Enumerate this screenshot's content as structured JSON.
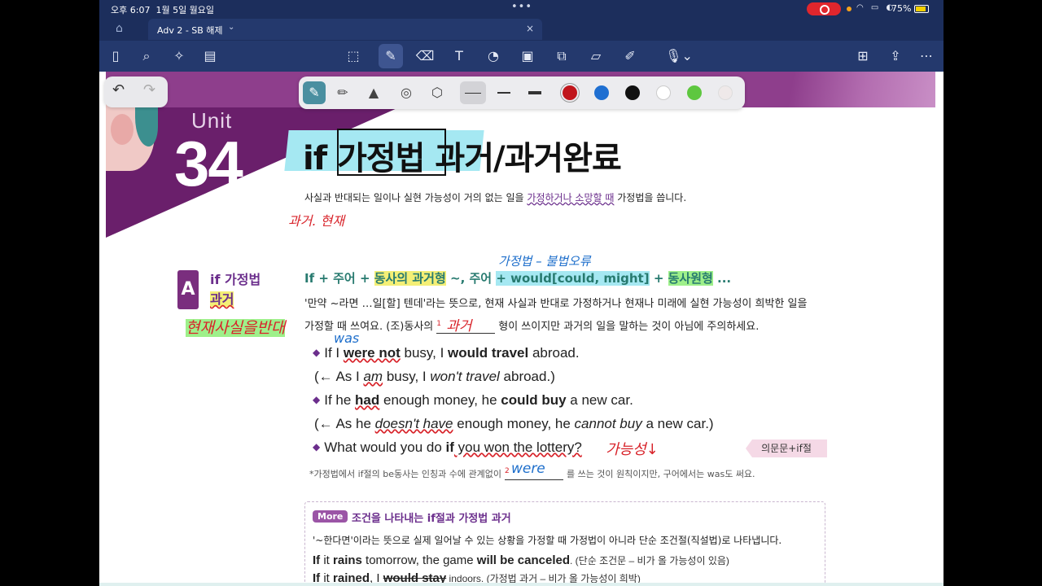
{
  "status_bar": {
    "time": "오후 6:07",
    "date": "1월 5일 월요일",
    "battery": "75%"
  },
  "tab": {
    "title": "Adv 2 - SB 해제",
    "close": "×"
  },
  "toolbar_icons": [
    "sidebar-icon",
    "search-icon",
    "magic-icon",
    "document-icon",
    "lasso-icon",
    "pen-icon",
    "eraser-icon",
    "textbox-icon",
    "shape-icon",
    "image-icon",
    "elements-icon",
    "sticky-note-icon",
    "laser-pointer-icon",
    "microphone-icon",
    "add-page-icon",
    "share-icon",
    "more-icon"
  ],
  "pen_toolbar": {
    "tools": [
      "pen-tool-icon",
      "pencil-tool-icon",
      "highlighter-tool-icon",
      "shape-tool-icon",
      "eraser-tool-icon"
    ],
    "colors": [
      "#c0151b",
      "#1f6fd1",
      "#111111",
      "#ffffff",
      "#5ec73f",
      "#efe9e9"
    ]
  },
  "page": {
    "unit_word": "Unit",
    "unit_number": "34",
    "title_if": "if",
    "title_boxed": "가정법",
    "title_rest": "과거/과거완료",
    "intro_a": "사실과 반대되는 일이나 실현 가능성이 거의 없는 일을",
    "intro_emph": "가정하거나 소망할 때",
    "intro_b": "가정법을 씁니다.",
    "hand_intro": "과거. 현재",
    "section_letter": "A",
    "section_title_1": "if 가정법",
    "section_title_2": "과거",
    "hand_section": "현재사실을반대",
    "hand_pattern": "가정법 – 불법오류",
    "pattern": {
      "a": "If + 주어 +",
      "b": "동사의 과거형",
      "c": " ~, 주어 ",
      "d": "+ would[could, might]",
      "e": " + ",
      "f": "동사원형",
      "g": " ..."
    },
    "explanation_1": "'만약 ~라면 …일[할] 텐데'라는 뜻으로, 현재 사실과 반대로 가정하거나 현재나 미래에 실현 가능성이 희박한 일을",
    "explanation_2a": "가정할 때 쓰여요. (조)동사의",
    "blank_1_num": "1",
    "blank_1_hand": "과거",
    "explanation_2b": "형이 쓰이지만 과거의 일을 말하는 것이 아님에 주의하세요.",
    "hand_was": "was",
    "ex1": {
      "a": "If I ",
      "b": "were not",
      "c": " busy, I ",
      "d": "would travel",
      "e": " abroad."
    },
    "ex2": {
      "a": "(← As I ",
      "b": "am",
      "c": " busy, I ",
      "d": "won't travel",
      "e": " abroad.)"
    },
    "ex3": {
      "a": "If he ",
      "b": "had",
      "c": " enough money, he ",
      "d": "could buy",
      "e": " a new car."
    },
    "ex4": {
      "a": "(← As he ",
      "b": "doesn't have",
      "c": " enough money, he ",
      "d": "cannot buy",
      "e": " a new car.)"
    },
    "ex5": {
      "a": "What would you do ",
      "b": "if",
      "c": " you won the lottery?"
    },
    "hand_possibility": "가능성↓",
    "question_tag": "의문문+if절",
    "note_a": "*가정법에서 if절의 be동사는 인칭과 수에 관계없이",
    "blank_2_num": "2",
    "blank_2_hand": "were",
    "note_b": "를 쓰는 것이 원칙이지만, 구어에서는 was도 써요.",
    "more_badge": "More",
    "more_title": "조건을 나타내는 if절과 가정법 과거",
    "more_text": "'~한다면'이라는 뜻으로 실제 일어날 수 있는 상황을 가정할 때 가정법이 아니라 단순 조건절(직설법)로 나타냅니다.",
    "more_ex1": {
      "a": "If",
      "b": " it ",
      "c": "rains",
      "d": " tomorrow, the game ",
      "e": "will be canceled",
      "f": ". (단순 조건문 – 비가 올 가능성이 있음)"
    },
    "more_ex2": {
      "a": "If",
      "b": " it ",
      "c": "rained",
      "d": ", I ",
      "e": "would stay",
      "f": " indoors. (가정법 과거 – 비가 올 가능성이 희박)"
    }
  }
}
